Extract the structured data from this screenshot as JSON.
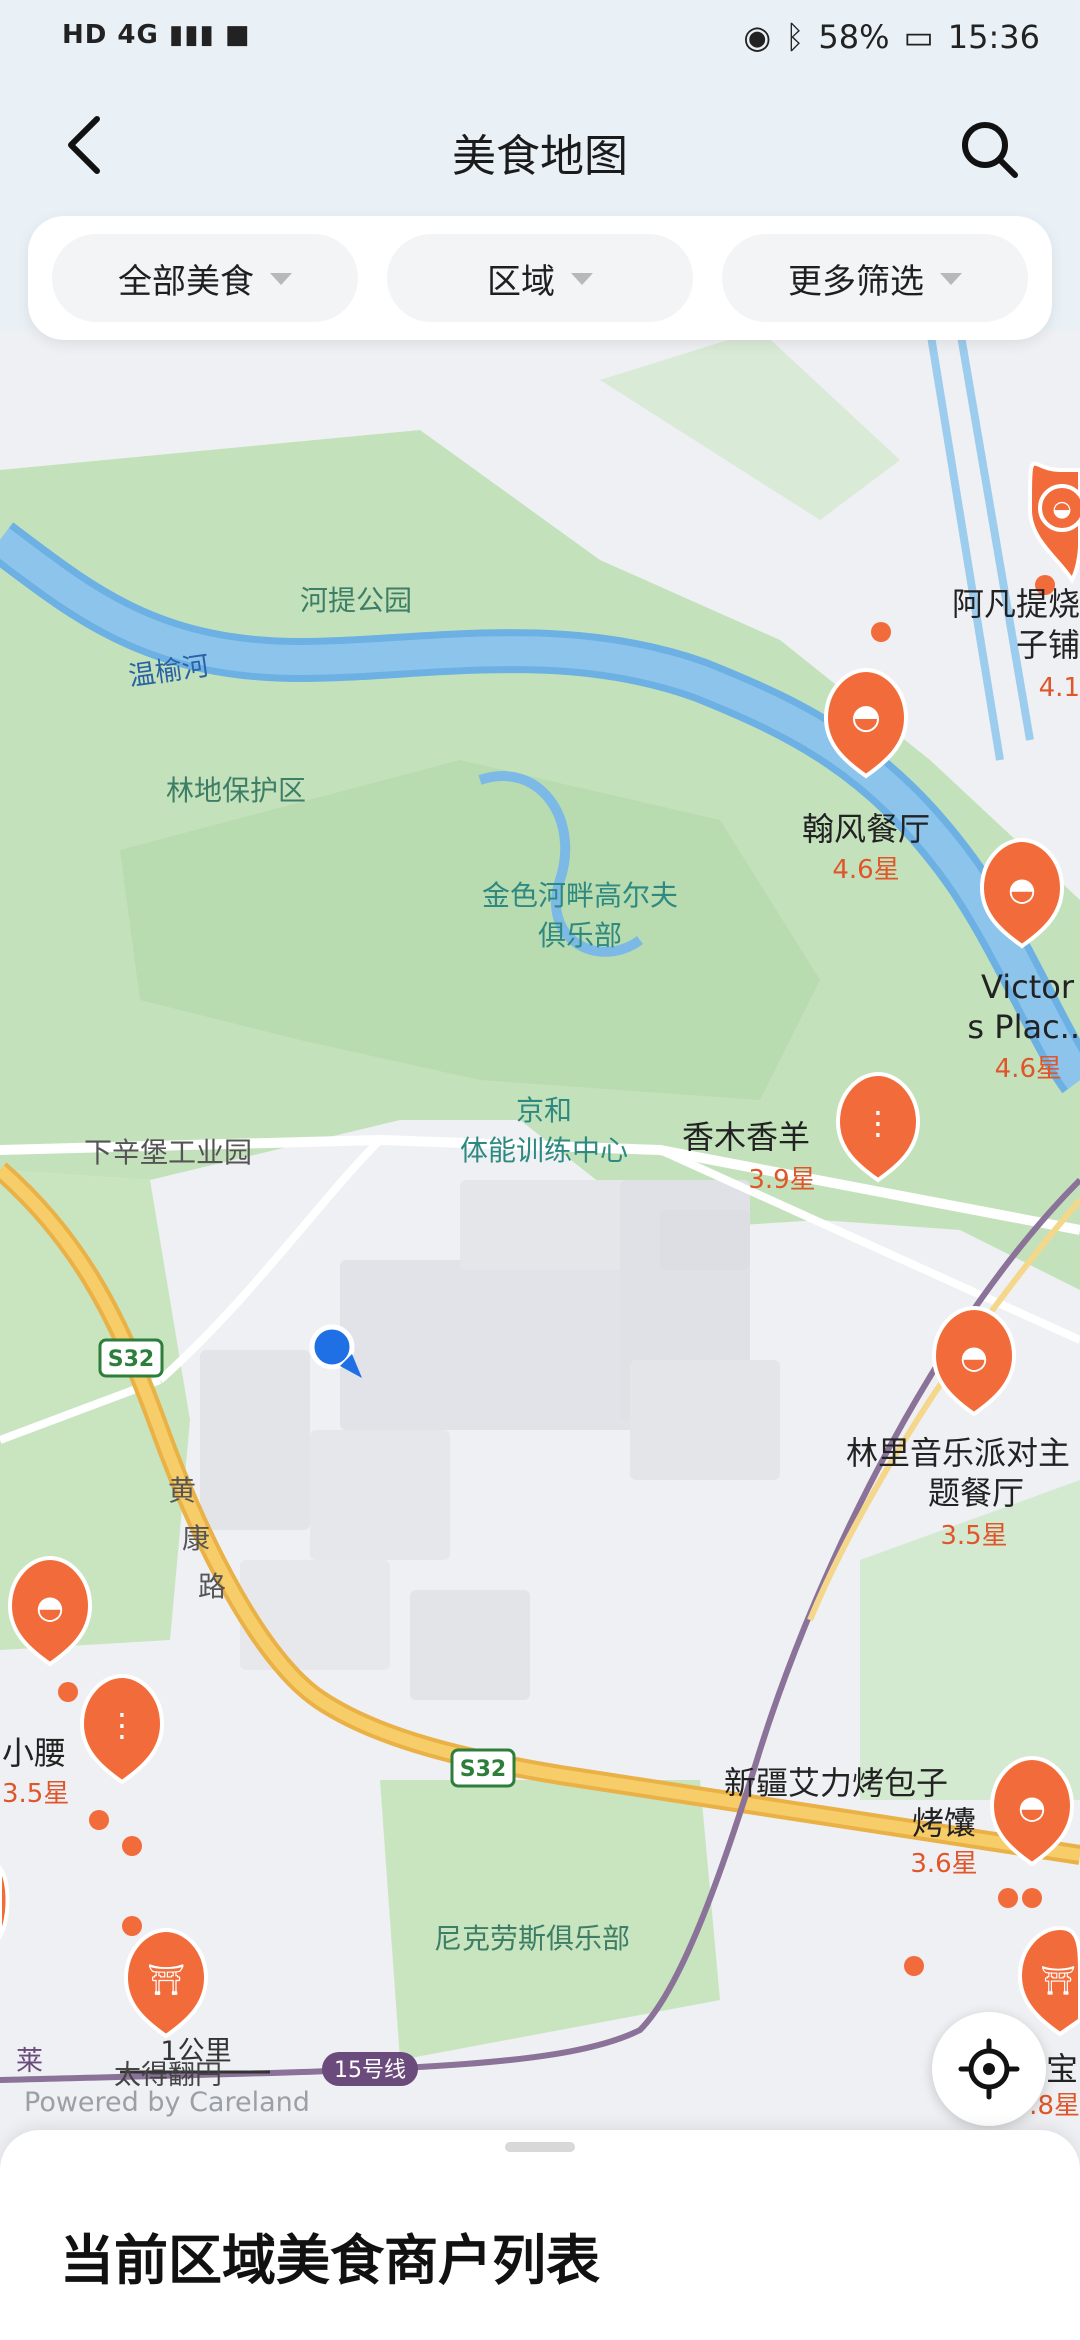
{
  "status_bar": {
    "network": "HD 4G",
    "battery": "58%",
    "time": "15:36",
    "icons": [
      "signal-icon",
      "video-icon",
      "eye-icon",
      "bluetooth-icon",
      "battery-icon"
    ]
  },
  "header": {
    "title": "美食地图",
    "back_icon": "chevron-left-icon",
    "search_icon": "search-icon"
  },
  "filters": [
    {
      "label": "全部美食"
    },
    {
      "label": "区域"
    },
    {
      "label": "更多筛选"
    }
  ],
  "map_labels": {
    "park_hedi": "河提公园",
    "river": "温榆河",
    "forest": "林地保护区",
    "golf_line1": "金色河畔高尔夫",
    "golf_line2": "俱乐部",
    "jinghe_line1": "京和",
    "jinghe_line2": "体能训练中心",
    "xiaxinpu": "下辛堡工业园",
    "road_s32_a": "S32",
    "road_s32_b": "S32",
    "huangkang_1": "黄",
    "huangkang_2": "康",
    "huangkang_3": "路",
    "nikes": "尼克劳斯俱乐部",
    "line15": "15号线",
    "scale": "1公里",
    "bottom_left_a": "莱",
    "bottom_left_b": "太得翻円"
  },
  "restaurants": [
    {
      "name": "阿凡提烧",
      "name2": "子铺",
      "rating": "4.1",
      "icon": "bowl-icon"
    },
    {
      "name": "翰风餐厅",
      "rating": "4.6星",
      "icon": "bowl-icon"
    },
    {
      "name": "Victor",
      "name2": "s Plac..",
      "rating": "4.6星",
      "icon": "pot-icon"
    },
    {
      "name": "香木香羊",
      "rating": "3.9星",
      "icon": "skewer-icon"
    },
    {
      "name": "林里音乐派对主",
      "name2": "题餐厅",
      "rating": "3.5星",
      "icon": "bowl-icon"
    },
    {
      "name": "小腰",
      "rating": "3.5星",
      "icon": "skewer-icon"
    },
    {
      "name": "新疆艾力烤包子",
      "name2": "烤馕",
      "rating": "3.6星",
      "icon": "bowl-icon"
    },
    {
      "name": "宝",
      "rating": "3.8星",
      "icon": "hotpot-icon"
    }
  ],
  "unlabeled_pins": [
    "bowl-icon",
    "skewer-icon",
    "hotpot-icon"
  ],
  "locate_icon": "crosshair-icon",
  "powered_by": "Powered by Careland",
  "sheet": {
    "title": "当前区域美食商户列表"
  },
  "colors": {
    "accent": "#f26b3a",
    "park": "#bfe0b8",
    "water": "#2f8cd2",
    "road": "#f1b84a",
    "metro": "#7a5c8a"
  }
}
